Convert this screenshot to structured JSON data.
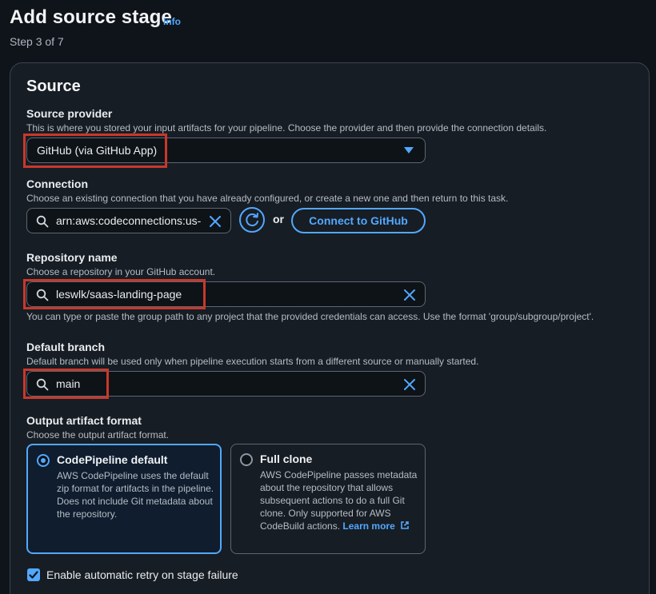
{
  "header": {
    "title": "Add source stage",
    "info_label": "Info",
    "step": "Step 3 of 7"
  },
  "source": {
    "section_title": "Source",
    "provider": {
      "label": "Source provider",
      "description": "This is where you stored your input artifacts for your pipeline. Choose the provider and then provide the connection details.",
      "selected": "GitHub (via GitHub App)",
      "icon": "chevron-down-icon"
    },
    "connection": {
      "label": "Connection",
      "description": "Choose an existing connection that you have already configured, or create a new one and then return to this task.",
      "value": "arn:aws:codeconnections:us-",
      "or_text": "or",
      "connect_button": "Connect to GitHub"
    },
    "repository": {
      "label": "Repository name",
      "description": "Choose a repository in your GitHub account.",
      "value": "leswlk/saas-landing-page",
      "hint": "You can type or paste the group path to any project that the provided credentials can access. Use the format 'group/subgroup/project'."
    },
    "branch": {
      "label": "Default branch",
      "description": "Default branch will be used only when pipeline execution starts from a different source or manually started.",
      "value": "main"
    },
    "artifact": {
      "label": "Output artifact format",
      "description": "Choose the output artifact format.",
      "options": [
        {
          "title": "CodePipeline default",
          "description": "AWS CodePipeline uses the default zip format for artifacts in the pipeline. Does not include Git metadata about the repository.",
          "selected": true
        },
        {
          "title": "Full clone",
          "description": "AWS CodePipeline passes metadata about the repository that allows subsequent actions to do a full Git clone. Only supported for AWS CodeBuild actions.",
          "link": "Learn more",
          "selected": false
        }
      ]
    },
    "retry": {
      "label": "Enable automatic retry on stage failure",
      "checked": true
    }
  },
  "colors": {
    "accent": "#52a8ff",
    "highlight": "#c8382b",
    "background": "#0f141a",
    "card": "#171d24"
  }
}
